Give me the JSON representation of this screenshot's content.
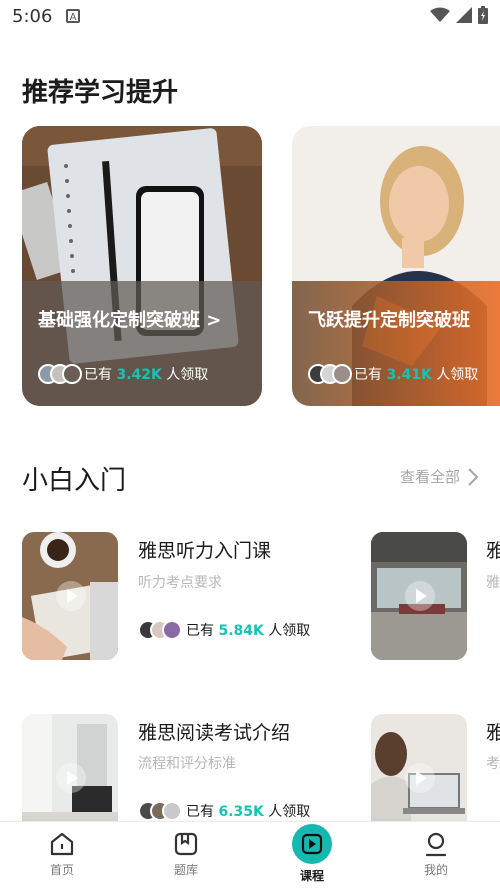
{
  "status_bar": {
    "time": "5:06",
    "notif_letter": "A"
  },
  "sections": {
    "recommend": {
      "title": "推荐学习提升"
    },
    "beginner": {
      "title": "小白入门",
      "see_all": "查看全部"
    }
  },
  "recommend_cards": [
    {
      "title": "基础强化定制突破班 >",
      "prefix": "已有",
      "count": "3.42K",
      "suffix": "人领取"
    },
    {
      "title": "飞跃提升定制突破班",
      "prefix": "已有",
      "count": "3.41K",
      "suffix": "人领取"
    }
  ],
  "courses": [
    {
      "title": "雅思听力入门课",
      "subtitle": "听力考点要求",
      "prefix": "已有",
      "count": "5.84K",
      "suffix": "人领取"
    },
    {
      "title": "雅思阅读考试介绍",
      "subtitle": "流程和评分标准",
      "prefix": "已有",
      "count": "6.35K",
      "suffix": "人领取"
    }
  ],
  "partial_second_column": {
    "row1_title": "雅",
    "row1_sub": "雅",
    "row2_title": "雅",
    "row2_sub": "考"
  },
  "tabs": [
    {
      "label": "首页",
      "icon": "home-icon",
      "active": false
    },
    {
      "label": "题库",
      "icon": "book-icon",
      "active": false
    },
    {
      "label": "课程",
      "icon": "play-icon",
      "active": true
    },
    {
      "label": "我的",
      "icon": "profile-icon",
      "active": false
    }
  ],
  "colors": {
    "accent": "#18c2b4",
    "tab_active_bg": "#17b8b0",
    "orange": "#ea6e28"
  }
}
